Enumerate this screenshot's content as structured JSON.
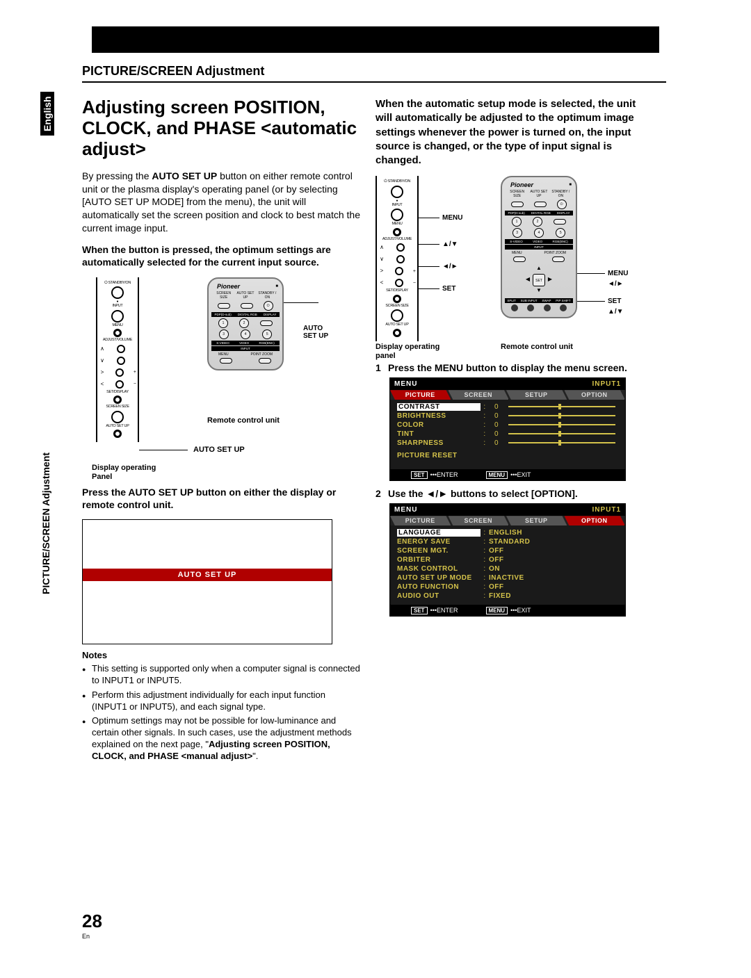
{
  "side": {
    "lang": "English",
    "section": "PICTURE/SCREEN Adjustment"
  },
  "header": "PICTURE/SCREEN Adjustment",
  "left": {
    "title": "Adjusting screen POSITION, CLOCK, and PHASE <automatic adjust>",
    "intro_a": "By pressing the ",
    "intro_bold": "AUTO SET UP",
    "intro_b": " button on either remote control unit or the plasma display's operating panel (or by selecting [AUTO SET UP MODE] from the menu), the unit will automatically set the screen position and clock to best match the current image input.",
    "sub1": "When the button is pressed, the optimum settings are automatically selected for the current input source.",
    "cap_remote": "Remote control unit",
    "cap_autosetup": "AUTO SET UP",
    "cap_autosetup2": "AUTO\nSET UP",
    "cap_panel": "Display operating\nPanel",
    "press": "Press the AUTO SET UP button on either the display or remote control unit.",
    "auto_strip": "AUTO SET UP",
    "notes_h": "Notes",
    "notes": [
      "This setting is supported only when a computer signal is connected to INPUT1 or INPUT5.",
      "Perform this adjustment individually for each input function (INPUT1 or INPUT5), and each signal type.",
      "Optimum settings may not be possible for low-luminance and certain other signals. In such cases, use the adjustment methods explained on the next page, \""
    ],
    "note3_bold": "Adjusting screen POSITION, CLOCK, and PHASE <manual adjust>",
    "note3_end": "\"."
  },
  "right": {
    "sub1": "When the automatic setup mode is selected, the unit will automatically be adjusted to the optimum image settings whenever the power is turned on, the input source is changed, or the type of input signal is changed.",
    "cap_panel": "Display operating\npanel",
    "cap_remote": "Remote control unit",
    "lbl_menu": "MENU",
    "lbl_arrows_ud": "▲/▼",
    "lbl_arrows_lr": "◄/►",
    "lbl_set": "SET",
    "step1": "Press the MENU button to display the menu screen.",
    "step2_a": "Use the ",
    "step2_b": " buttons to select [OPTION].",
    "osd": {
      "menu": "MENU",
      "input1": "INPUT1",
      "tabs": [
        "PICTURE",
        "SCREEN",
        "SETUP",
        "OPTION"
      ],
      "pic_rows": [
        {
          "k": "CONTRAST",
          "v": "0"
        },
        {
          "k": "BRIGHTNESS",
          "v": "0"
        },
        {
          "k": "COLOR",
          "v": "0"
        },
        {
          "k": "TINT",
          "v": "0"
        },
        {
          "k": "SHARPNESS",
          "v": "0"
        }
      ],
      "pic_reset": "PICTURE RESET",
      "opt_rows": [
        {
          "k": "LANGUAGE",
          "v": "ENGLISH"
        },
        {
          "k": "ENERGY SAVE",
          "v": "STANDARD"
        },
        {
          "k": "SCREEN MGT.",
          "v": "OFF"
        },
        {
          "k": "ORBITER",
          "v": "OFF"
        },
        {
          "k": "MASK CONTROL",
          "v": "ON"
        },
        {
          "k": "AUTO SET UP MODE",
          "v": "INACTIVE"
        },
        {
          "k": "AUTO FUNCTION",
          "v": "OFF"
        },
        {
          "k": "AUDIO OUT",
          "v": "FIXED"
        }
      ],
      "foot_set": "SET",
      "foot_enter": "•••ENTER",
      "foot_menu": "MENU",
      "foot_exit": "•••EXIT"
    }
  },
  "footer": {
    "page": "28",
    "lang": "En"
  },
  "panel": {
    "standby": "STANDBY/ON",
    "input": "INPUT",
    "menu": "MENU",
    "adjvol": "ADJUST/VOLUME",
    "setdisp": "SET/DISPLAY",
    "scrsize": "SCREEN SIZE",
    "autosetup": "AUTO SET UP"
  },
  "remote": {
    "brand": "Pioneer",
    "r1": [
      "SCREEN SIZE",
      "AUTO SET UP",
      "STANDBY / ON"
    ],
    "strip1": [
      "PDP(D-sub)",
      "DIGITAL RGB",
      "DISPLAY"
    ],
    "strip2": [
      "S-VIDEO",
      "VIDEO",
      "RGB(BNC)"
    ],
    "input": "INPUT",
    "r3": [
      "MENU",
      "POINT ZOOM"
    ],
    "set": "SET",
    "bottom": [
      "SPLIT",
      "SUB INPUT",
      "SWAP",
      "PIP SHIFT"
    ]
  }
}
